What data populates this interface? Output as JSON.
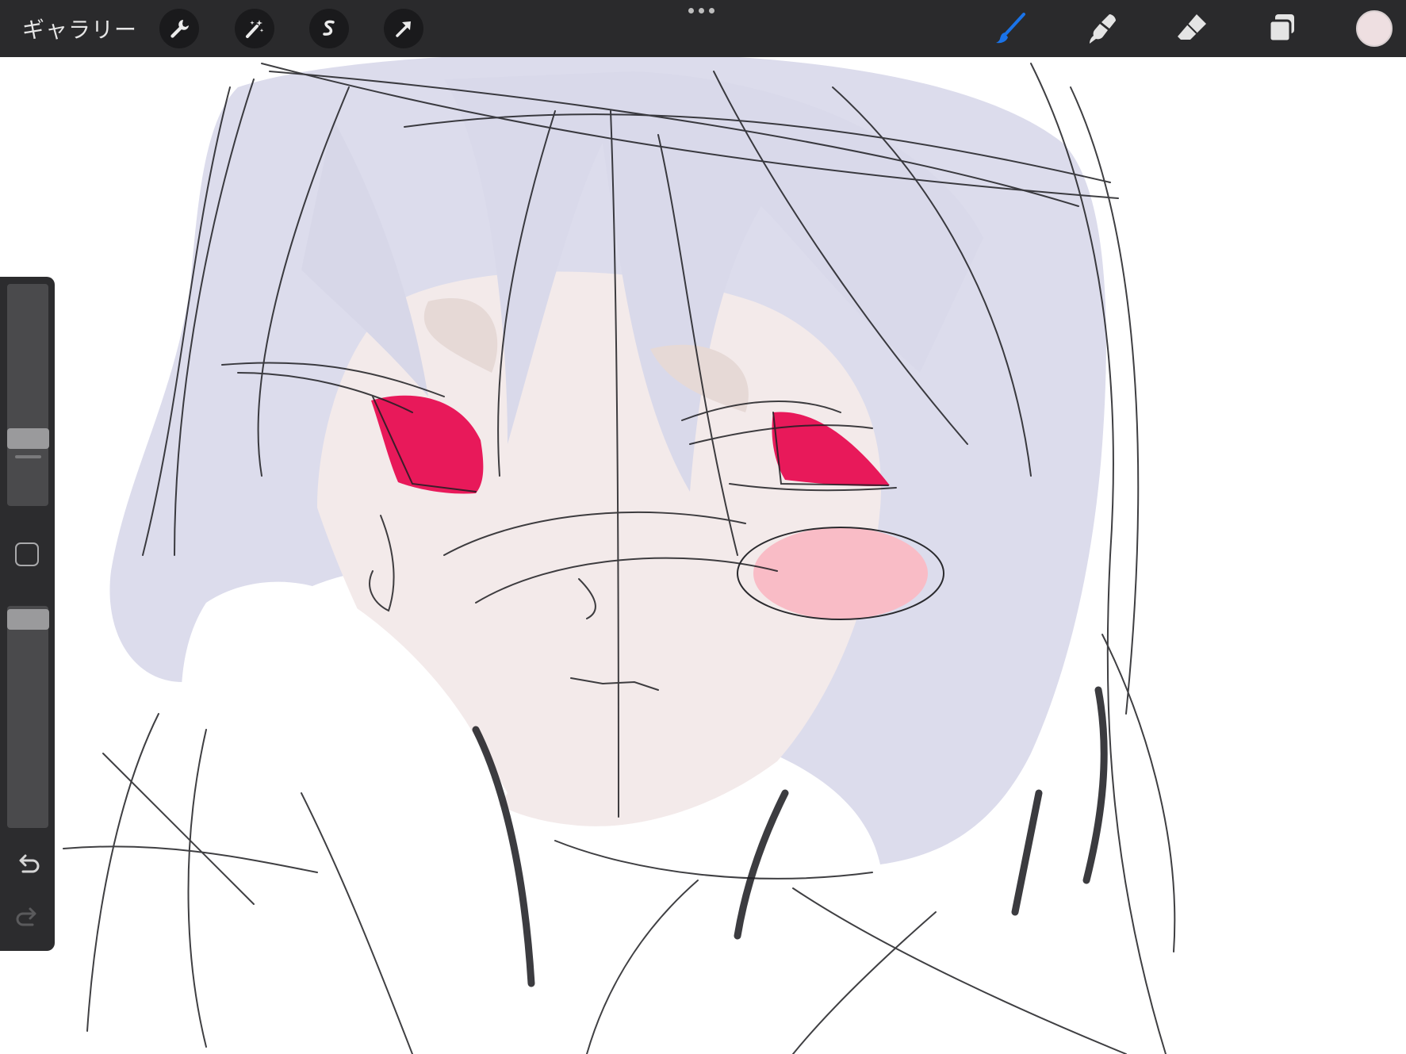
{
  "toolbar": {
    "gallery_label": "ギャラリー",
    "left_icons": [
      "wrench-icon",
      "magic-wand-icon",
      "selection-s-icon",
      "transform-arrow-icon"
    ],
    "more_icon": "three-dots-icon",
    "right_icons": [
      "brush-icon",
      "smudge-icon",
      "eraser-icon",
      "layers-icon"
    ],
    "active_tool": "brush-icon",
    "active_color": "#1a73e8",
    "current_color": "#eedfe1"
  },
  "sidebar": {
    "brush_size": 0.71,
    "opacity": 1.0,
    "icons": [
      "modify-square-icon",
      "undo-icon",
      "redo-icon"
    ]
  },
  "canvas": {
    "hair_color": "#dcdcec",
    "skin_color": "#f3eaea",
    "eye_color": "#e8195a",
    "blush_color": "#f9bcc6",
    "line_color": "#1e1e22"
  }
}
